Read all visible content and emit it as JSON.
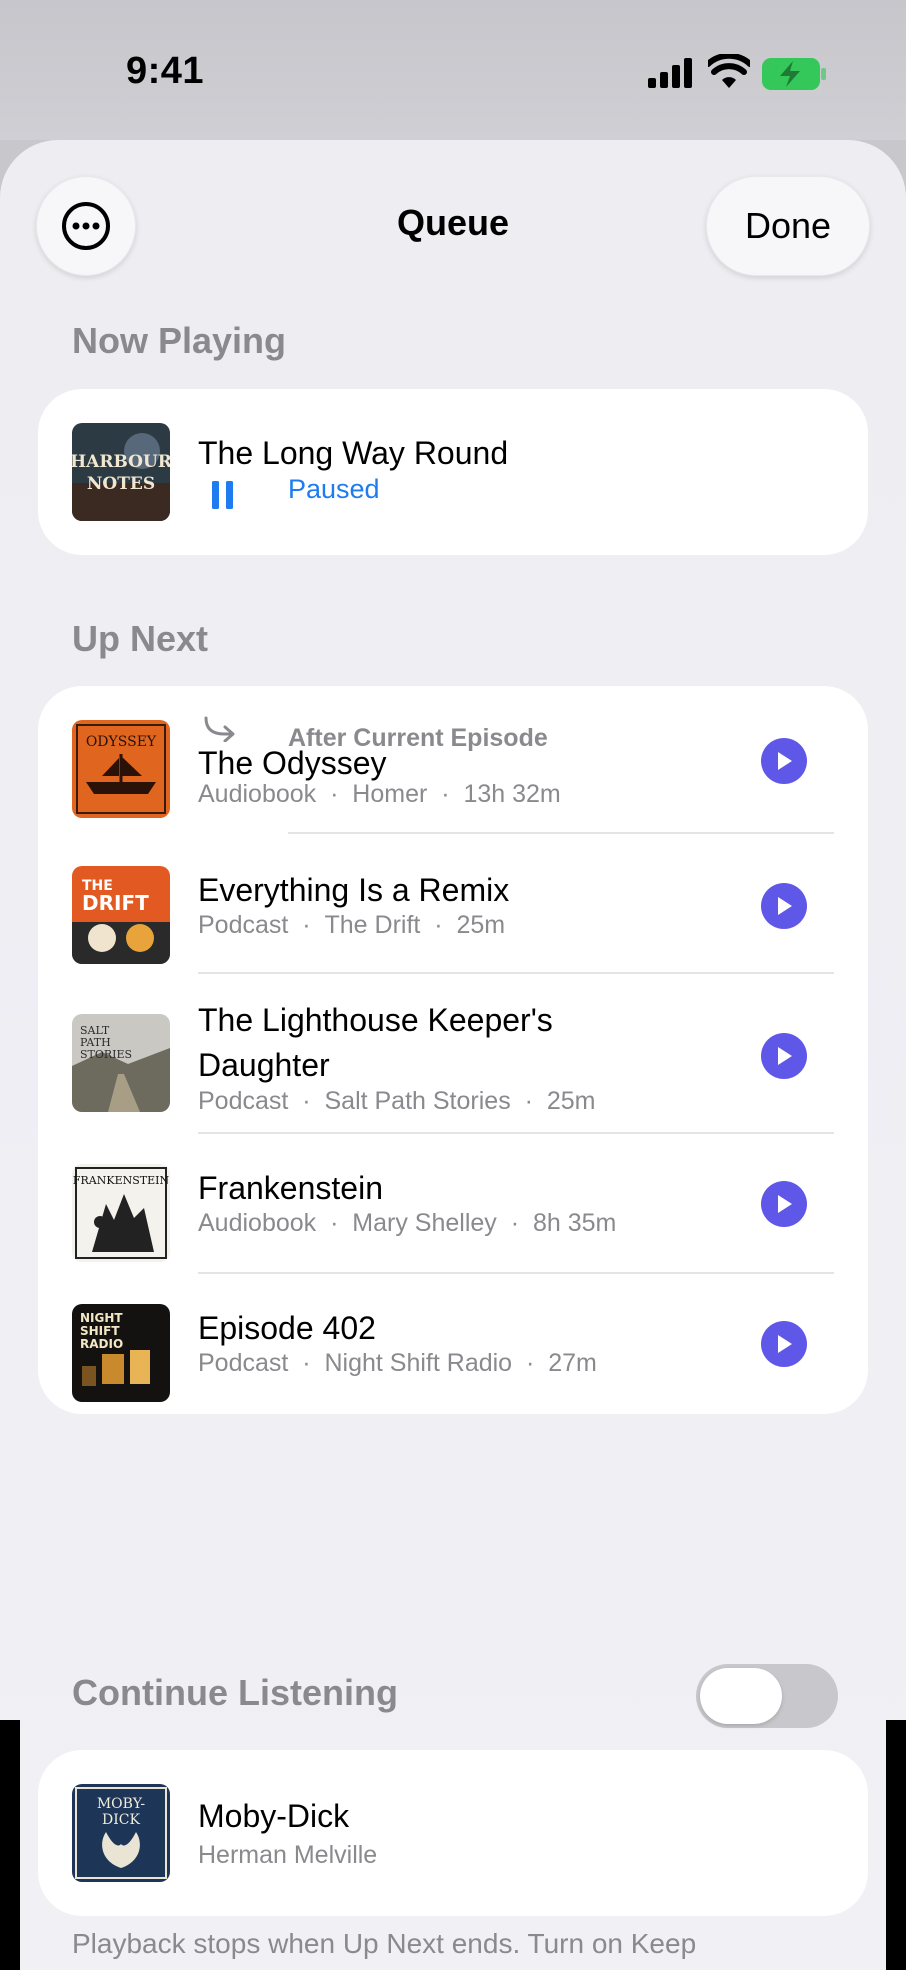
{
  "status_bar": {
    "time": "9:41"
  },
  "header": {
    "title": "Queue",
    "more_icon": "ellipsis-circle-icon",
    "done_label": "Done"
  },
  "now_playing": {
    "section_label": "Now Playing",
    "item": {
      "title": "The Long Way Round",
      "state": "Paused",
      "artwork_text": "HARBOUR NOTES"
    }
  },
  "up_next": {
    "section_label": "Up Next",
    "after_current_label": "After Current Episode",
    "items": [
      {
        "title": "The Odyssey",
        "type": "Audiobook",
        "author": "Homer",
        "duration": "13h 32m",
        "artwork_text": "ODYSSEY"
      },
      {
        "title": "Everything Is a Remix",
        "type": "Podcast",
        "author": "The Drift",
        "duration": "25m",
        "artwork_text": "THE DRIFT"
      },
      {
        "title": "The Lighthouse Keeper's Daughter",
        "type": "Podcast",
        "author": "Salt Path Stories",
        "duration": "25m",
        "artwork_text": "SALT PATH STORIES"
      },
      {
        "title": "Frankenstein",
        "type": "Audiobook",
        "author": "Mary Shelley",
        "duration": "8h 35m",
        "artwork_text": "FRANKENSTEIN"
      },
      {
        "title": "Episode 402",
        "type": "Podcast",
        "author": "Night Shift Radio",
        "duration": "27m",
        "artwork_text": "NIGHT SHIFT RADIO"
      }
    ],
    "separator": "·"
  },
  "continue_listening": {
    "section_label": "Continue Listening",
    "toggle_on": false,
    "item": {
      "title": "Moby-Dick",
      "author": "Herman Melville",
      "artwork_text": "MOBY-DICK"
    },
    "footer_note": "Playback stops when Up Next ends. Turn on Keep"
  },
  "colors": {
    "accent": "#5f57e8",
    "paused_blue": "#1e7cf0",
    "secondary_text": "#8a8a8e"
  }
}
